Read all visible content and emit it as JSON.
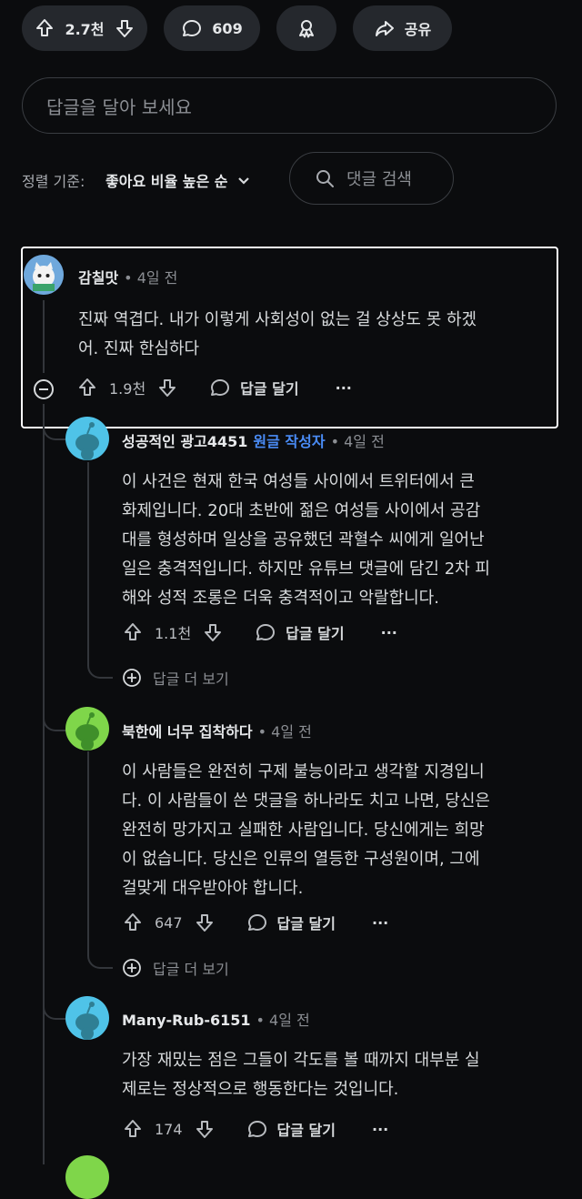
{
  "post_actions": {
    "vote_count": "2.7천",
    "comment_count": "609",
    "share_label": "공유"
  },
  "reply_input": {
    "placeholder": "답글을 달아 보세요"
  },
  "sort": {
    "label": "정렬 기준:",
    "value": "좋아요 비율 높은 순"
  },
  "comment_search": {
    "placeholder": "댓글 검색"
  },
  "comments": [
    {
      "author": "감칠맛",
      "meta": "• 4일 전",
      "lines": [
        "진짜 역겹다. 내가 이렇게 사회성이 없는 걸 상상도 못 하겠",
        "어. 진짜 한심하다"
      ],
      "votes": "1.9천",
      "reply_label": "답글 달기",
      "more": "···",
      "avatar_color": "#6fa8dc"
    },
    {
      "author": "성공적인 광고4451",
      "op_badge": "원글 작성자",
      "meta": "• 4일 전",
      "lines": [
        "이 사건은 현재 한국 여성들 사이에서 트위터에서 큰",
        "화제입니다. 20대 초반에 젊은 여성들 사이에서 공감",
        "대를 형성하며 일상을 공유했던 곽혈수 씨에게 일어난",
        "일은 충격적입니다. 하지만 유튜브 댓글에 담긴 2차 피",
        "해와 성적 조롱은 더욱 충격적이고 악랄합니다."
      ],
      "votes": "1.1천",
      "reply_label": "답글 달기",
      "more": "···",
      "more_replies": "답글 더 보기",
      "avatar_color": "#4fc3e8"
    },
    {
      "author": "북한에 너무 집착하다",
      "meta": "• 4일 전",
      "lines": [
        "이 사람들은 완전히 구제 불능이라고 생각할 지경입니",
        "다. 이 사람들이 쓴 댓글을 하나라도 치고 나면, 당신은",
        "완전히 망가지고 실패한 사람입니다. 당신에게는 희망",
        "이 없습니다. 당신은 인류의 열등한 구성원이며, 그에",
        "걸맞게 대우받아야 합니다."
      ],
      "votes": "647",
      "reply_label": "답글 달기",
      "more": "···",
      "more_replies": "답글 더 보기",
      "avatar_color": "#7fd64a"
    },
    {
      "author": "Many-Rub-6151",
      "meta": "• 4일 전",
      "lines": [
        "가장 재밌는 점은 그들이 각도를 볼 때까지 대부분 실",
        "제로는 정상적으로 행동한다는 것입니다."
      ],
      "votes": "174",
      "reply_label": "답글 달기",
      "more": "···",
      "avatar_color": "#4fc3e8"
    }
  ]
}
